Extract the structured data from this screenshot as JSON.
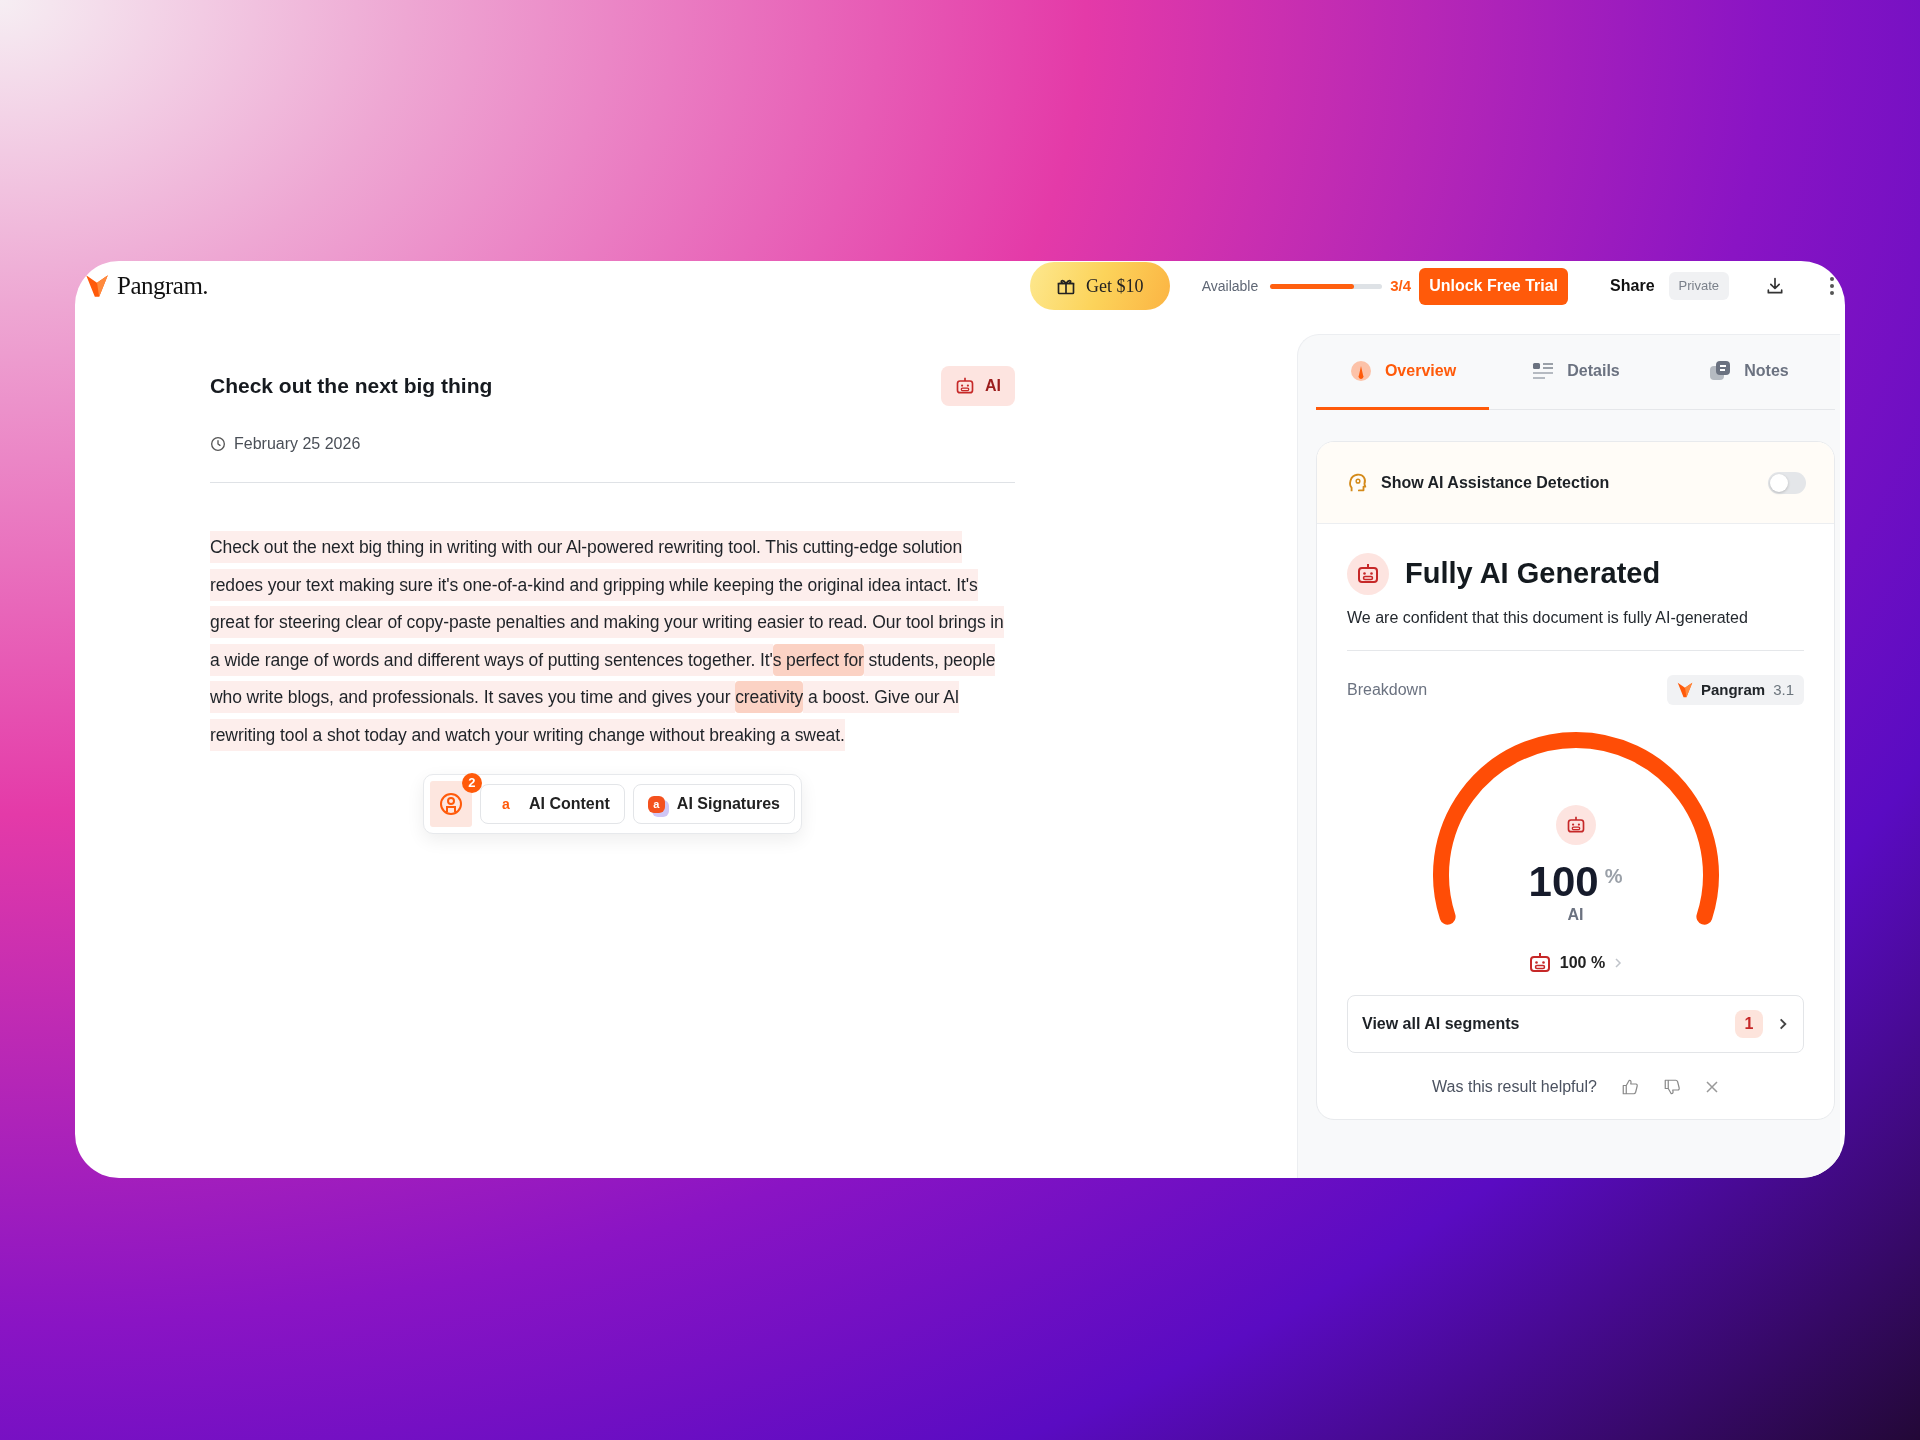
{
  "header": {
    "logo": "Pangram.",
    "promo": "Get $10",
    "usage": {
      "label": "Available",
      "level": 0.75,
      "reading": "3/4"
    },
    "cta": "Unlock Free Trial",
    "share": "Share",
    "visibility": "Private"
  },
  "document": {
    "title": "Check out the next big thing",
    "badge": "AI",
    "date": "February 25 2026",
    "segments": [
      {
        "text": "Check out the next big thing in writing with our Al-powered rewriting tool. This cutting-edge solution redoes your text making sure it's one-of-a-kind and gripping while keeping the original idea intact. It's great for steering clear of copy-paste penalties and making your writing easier to read. Our tool brings in a wide range of words and different ways of putting sentences together. It'",
        "strong": false
      },
      {
        "text": "s perfect for",
        "strong": true
      },
      {
        "text": " students, people who write blogs, and professionals. It saves you time and gives your ",
        "strong": false
      },
      {
        "text": "creativity",
        "strong": true
      },
      {
        "text": " a boost. Give our Al rewriting tool a shot today and watch your writing change without breaking a sweat.",
        "strong": false
      }
    ]
  },
  "toolbar": {
    "count": "2",
    "buttons": [
      {
        "kind": "content",
        "icon_letter": "a",
        "label": "AI Content"
      },
      {
        "kind": "signatures",
        "icon_letter": "a",
        "label": "AI Signatures"
      }
    ]
  },
  "panel": {
    "tabs": [
      {
        "kind": "overview",
        "label": "Overview",
        "selected": true
      },
      {
        "kind": "details",
        "label": "Details",
        "selected": false
      },
      {
        "kind": "notes",
        "label": "Notes",
        "selected": false
      }
    ],
    "toggle": {
      "label": "Show AI Assistance Detection",
      "on": false
    },
    "verdict": {
      "title": "Fully AI Generated",
      "description": "We are confident that this document is fully AI-generated"
    },
    "breakdown": {
      "label": "Breakdown",
      "model": "Pangram",
      "version": "3.1"
    },
    "gauge": {
      "value": "100",
      "unit": "%",
      "label": "AI"
    },
    "summary": "100 %",
    "segments_link": {
      "label": "View all AI segments",
      "count": "1"
    },
    "feedback": "Was this result helpful?"
  }
}
